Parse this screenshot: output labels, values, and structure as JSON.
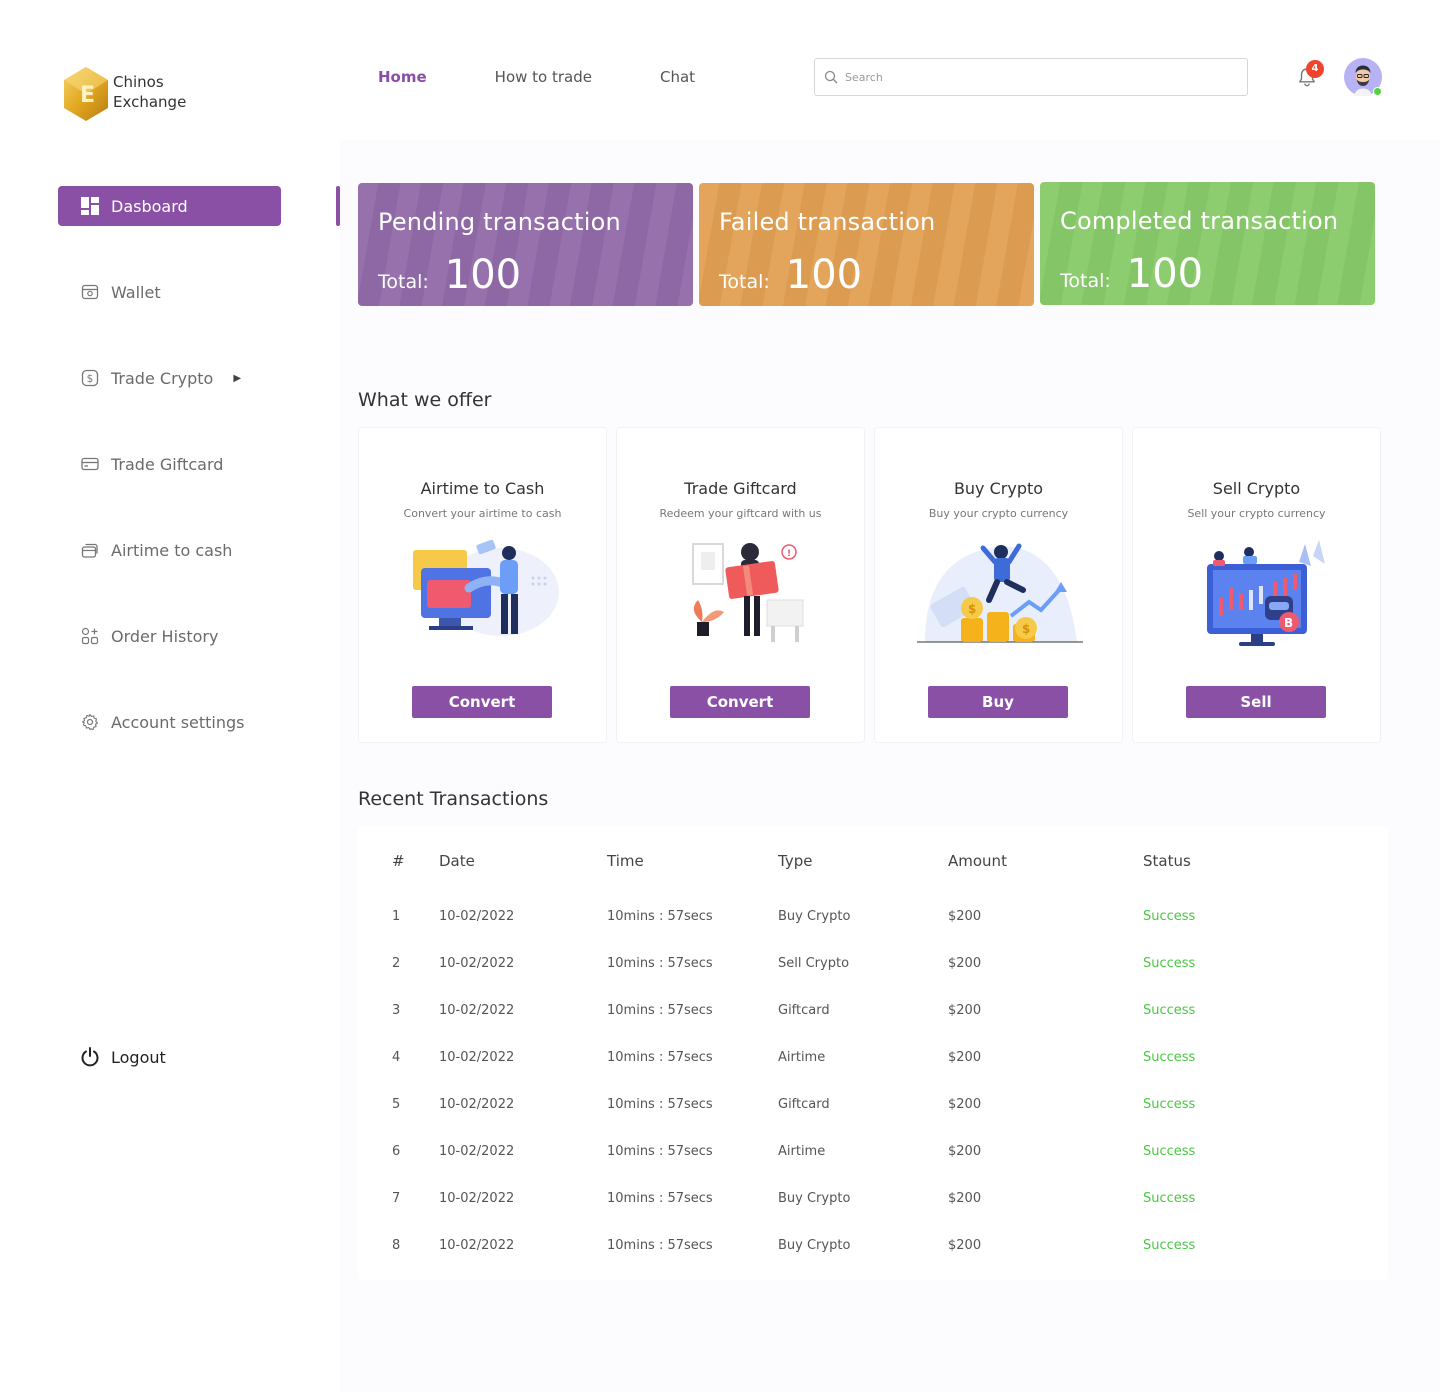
{
  "brand": {
    "line1": "Chinos",
    "line2": "Exchange",
    "mark": "E"
  },
  "topnav": [
    {
      "label": "Home",
      "active": true
    },
    {
      "label": "How to trade",
      "active": false
    },
    {
      "label": "Chat",
      "active": false
    }
  ],
  "search": {
    "placeholder": "Search",
    "value": ""
  },
  "notifications": {
    "count": "4",
    "icon": "bell-icon"
  },
  "user": {
    "avatar_icon": "user-avatar",
    "online": true
  },
  "sidebar": {
    "items": [
      {
        "label": "Dasboard",
        "icon": "dashboard-icon",
        "active": true
      },
      {
        "label": "Wallet",
        "icon": "wallet-icon"
      },
      {
        "label": "Trade Crypto",
        "icon": "dollar-icon",
        "has_submenu": true
      },
      {
        "label": "Trade Giftcard",
        "icon": "card-icon"
      },
      {
        "label": "Airtime to cash",
        "icon": "cards-icon"
      },
      {
        "label": "Order History",
        "icon": "history-icon"
      },
      {
        "label": "Account settings",
        "icon": "gear-icon"
      }
    ],
    "logout_label": "Logout"
  },
  "stats": [
    {
      "title": "Pending transaction",
      "total_label": "Total:",
      "value": "100",
      "color": "#936ba9"
    },
    {
      "title": "Failed transaction",
      "total_label": "Total:",
      "value": "100",
      "color": "#e2a155"
    },
    {
      "title": "Completed transaction",
      "total_label": "Total:",
      "value": "100",
      "color": "#88cb6a"
    }
  ],
  "offers_title": "What we offer",
  "offers": [
    {
      "title": "Airtime to Cash",
      "subtitle": "Convert your airtime to cash",
      "button": "Convert"
    },
    {
      "title": "Trade Giftcard",
      "subtitle": "Redeem your giftcard with us",
      "button": "Convert"
    },
    {
      "title": "Buy Crypto",
      "subtitle": "Buy your crypto currency",
      "button": "Buy"
    },
    {
      "title": "Sell Crypto",
      "subtitle": "Sell your crypto currency",
      "button": "Sell"
    }
  ],
  "transactions_title": "Recent Transactions",
  "table": {
    "columns": [
      "#",
      "Date",
      "Time",
      "Type",
      "Amount",
      "Status"
    ],
    "rows": [
      [
        "1",
        "10-02/2022",
        "10mins : 57secs",
        "Buy Crypto",
        "$200",
        "Success"
      ],
      [
        "2",
        "10-02/2022",
        "10mins : 57secs",
        "Sell Crypto",
        "$200",
        "Success"
      ],
      [
        "3",
        "10-02/2022",
        "10mins : 57secs",
        "Giftcard",
        "$200",
        "Success"
      ],
      [
        "4",
        "10-02/2022",
        "10mins : 57secs",
        "Airtime",
        "$200",
        "Success"
      ],
      [
        "5",
        "10-02/2022",
        "10mins : 57secs",
        "Giftcard",
        "$200",
        "Success"
      ],
      [
        "6",
        "10-02/2022",
        "10mins : 57secs",
        "Airtime",
        "$200",
        "Success"
      ],
      [
        "7",
        "10-02/2022",
        "10mins : 57secs",
        "Buy Crypto",
        "$200",
        "Success"
      ],
      [
        "8",
        "10-02/2022",
        "10mins : 57secs",
        "Buy Crypto",
        "$200",
        "Success"
      ]
    ]
  },
  "colors": {
    "accent": "#8a50a6",
    "success": "#48c940",
    "badge": "#f0442d"
  }
}
